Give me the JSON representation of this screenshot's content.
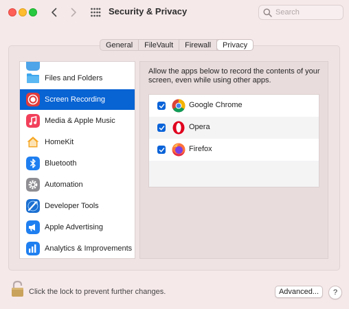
{
  "window": {
    "title": "Security & Privacy",
    "search_placeholder": "Search"
  },
  "tabs": [
    {
      "label": "General",
      "selected": false
    },
    {
      "label": "FileVault",
      "selected": false
    },
    {
      "label": "Firewall",
      "selected": false
    },
    {
      "label": "Privacy",
      "selected": true
    }
  ],
  "sidebar": {
    "items": [
      {
        "label": "Files and Folders",
        "icon": "folder-icon",
        "selected": false
      },
      {
        "label": "Screen Recording",
        "icon": "screen-recording-icon",
        "selected": true
      },
      {
        "label": "Media & Apple Music",
        "icon": "music-icon",
        "selected": false
      },
      {
        "label": "HomeKit",
        "icon": "homekit-icon",
        "selected": false
      },
      {
        "label": "Bluetooth",
        "icon": "bluetooth-icon",
        "selected": false
      },
      {
        "label": "Automation",
        "icon": "gear-icon",
        "selected": false
      },
      {
        "label": "Developer Tools",
        "icon": "developer-tools-icon",
        "selected": false
      },
      {
        "label": "Apple Advertising",
        "icon": "megaphone-icon",
        "selected": false
      },
      {
        "label": "Analytics & Improvements",
        "icon": "analytics-icon",
        "selected": false
      }
    ]
  },
  "detail": {
    "description": "Allow the apps below to record the contents of your screen, even while using other apps.",
    "apps": [
      {
        "name": "Google Chrome",
        "checked": true,
        "icon": "chrome-icon"
      },
      {
        "name": "Opera",
        "checked": true,
        "icon": "opera-icon"
      },
      {
        "name": "Firefox",
        "checked": true,
        "icon": "firefox-icon"
      }
    ]
  },
  "footer": {
    "lock_text": "Click the lock to prevent further changes.",
    "advanced_label": "Advanced...",
    "help_label": "?"
  }
}
